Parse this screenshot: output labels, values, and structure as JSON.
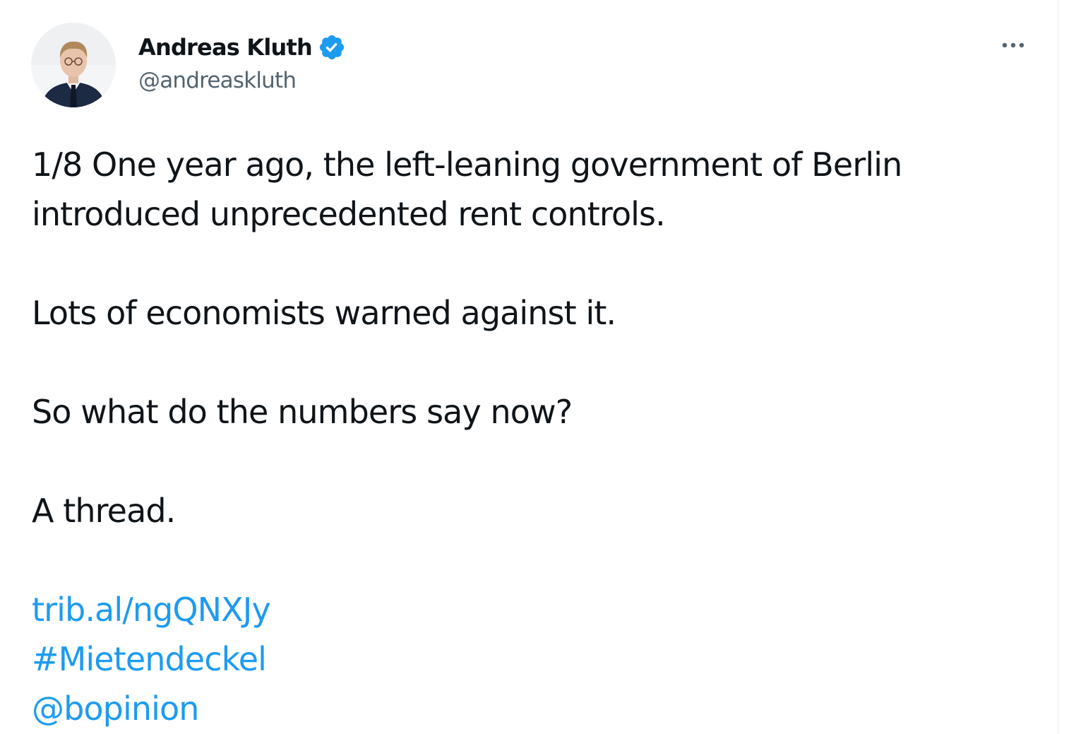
{
  "author": {
    "name": "Andreas Kluth",
    "handle": "@andreaskluth",
    "verified_icon": "verified-badge-icon",
    "verified_color": "#1d9bf0"
  },
  "menu": {
    "icon": "more-horizontal-icon"
  },
  "tweet": {
    "line1": "1/8 One year ago, the left-leaning government of Berlin",
    "line2": "introduced unprecedented rent controls.",
    "para2": "Lots of economists warned against it.",
    "para3": "So what do the numbers say now?",
    "para4": "A thread.",
    "link_url": "trib.al/ngQNXJy",
    "hashtag": "#Mietendeckel",
    "mention": "@bopinion"
  },
  "colors": {
    "text": "#0f1419",
    "secondary": "#536471",
    "link": "#1d9bf0"
  }
}
